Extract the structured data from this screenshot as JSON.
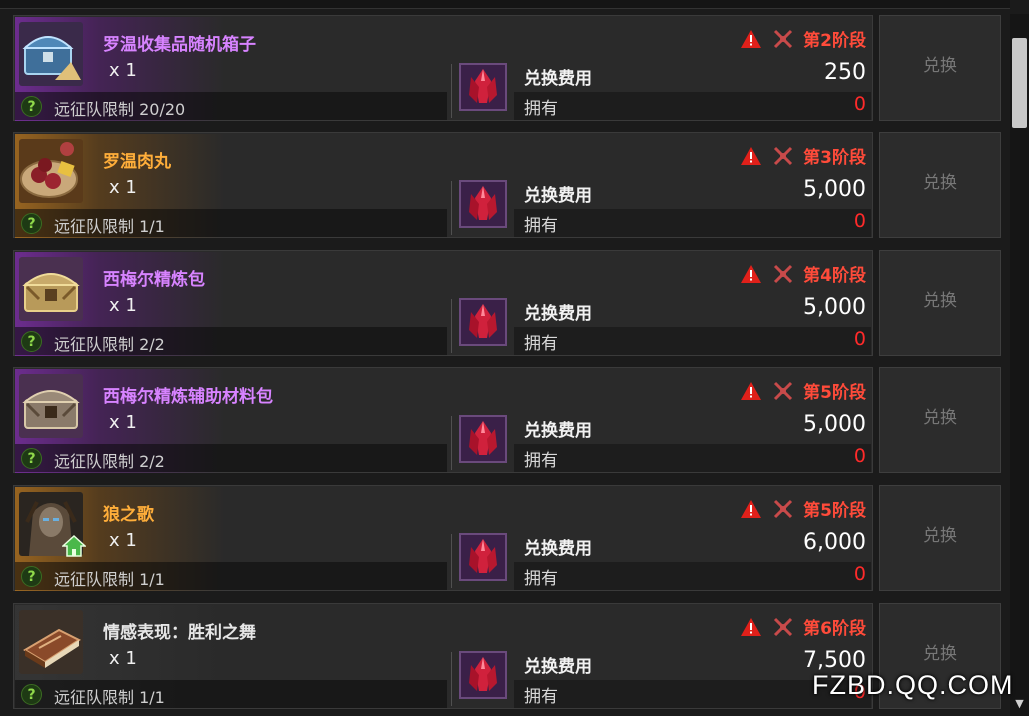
{
  "exchange_button_label": "兑换",
  "cost_label": "兑换费用",
  "own_label": "拥有",
  "help_symbol": "?",
  "watermark": "FZBD.QQ.COM",
  "colors": {
    "purple_name": "#d783ff",
    "orange_name": "#ffae3a",
    "stage_red": "#ff4b3a",
    "owned_red": "#ff2a2a"
  },
  "items": [
    {
      "name": "罗温收集品随机箱子",
      "name_color": "purple",
      "icon": "blue-chest-icon",
      "qty": "x 1",
      "limit": "远征队限制 20/20",
      "stage": "第2阶段",
      "cost": "250",
      "owned": "0"
    },
    {
      "name": "罗温肉丸",
      "name_color": "orange",
      "icon": "meatball-plate-icon",
      "qty": "x 1",
      "limit": "远征队限制 1/1",
      "stage": "第3阶段",
      "cost": "5,000",
      "owned": "0"
    },
    {
      "name": "西梅尔精炼包",
      "name_color": "purple",
      "icon": "gold-chest-icon",
      "qty": "x 1",
      "limit": "远征队限制 2/2",
      "stage": "第4阶段",
      "cost": "5,000",
      "owned": "0"
    },
    {
      "name": "西梅尔精炼辅助材料包",
      "name_color": "purple",
      "icon": "ornate-chest-icon",
      "qty": "x 1",
      "limit": "远征队限制 2/2",
      "stage": "第5阶段",
      "cost": "5,000",
      "owned": "0"
    },
    {
      "name": "狼之歌",
      "name_color": "orange",
      "icon": "wolf-portrait-icon",
      "qty": "x 1",
      "limit": "远征队限制 1/1",
      "stage": "第5阶段",
      "cost": "6,000",
      "owned": "0"
    },
    {
      "name": "情感表现：胜利之舞",
      "name_color": "white",
      "icon": "emote-book-icon",
      "qty": "x 1",
      "limit": "远征队限制 1/1",
      "stage": "第6阶段",
      "cost": "7,500",
      "owned": "0"
    }
  ]
}
